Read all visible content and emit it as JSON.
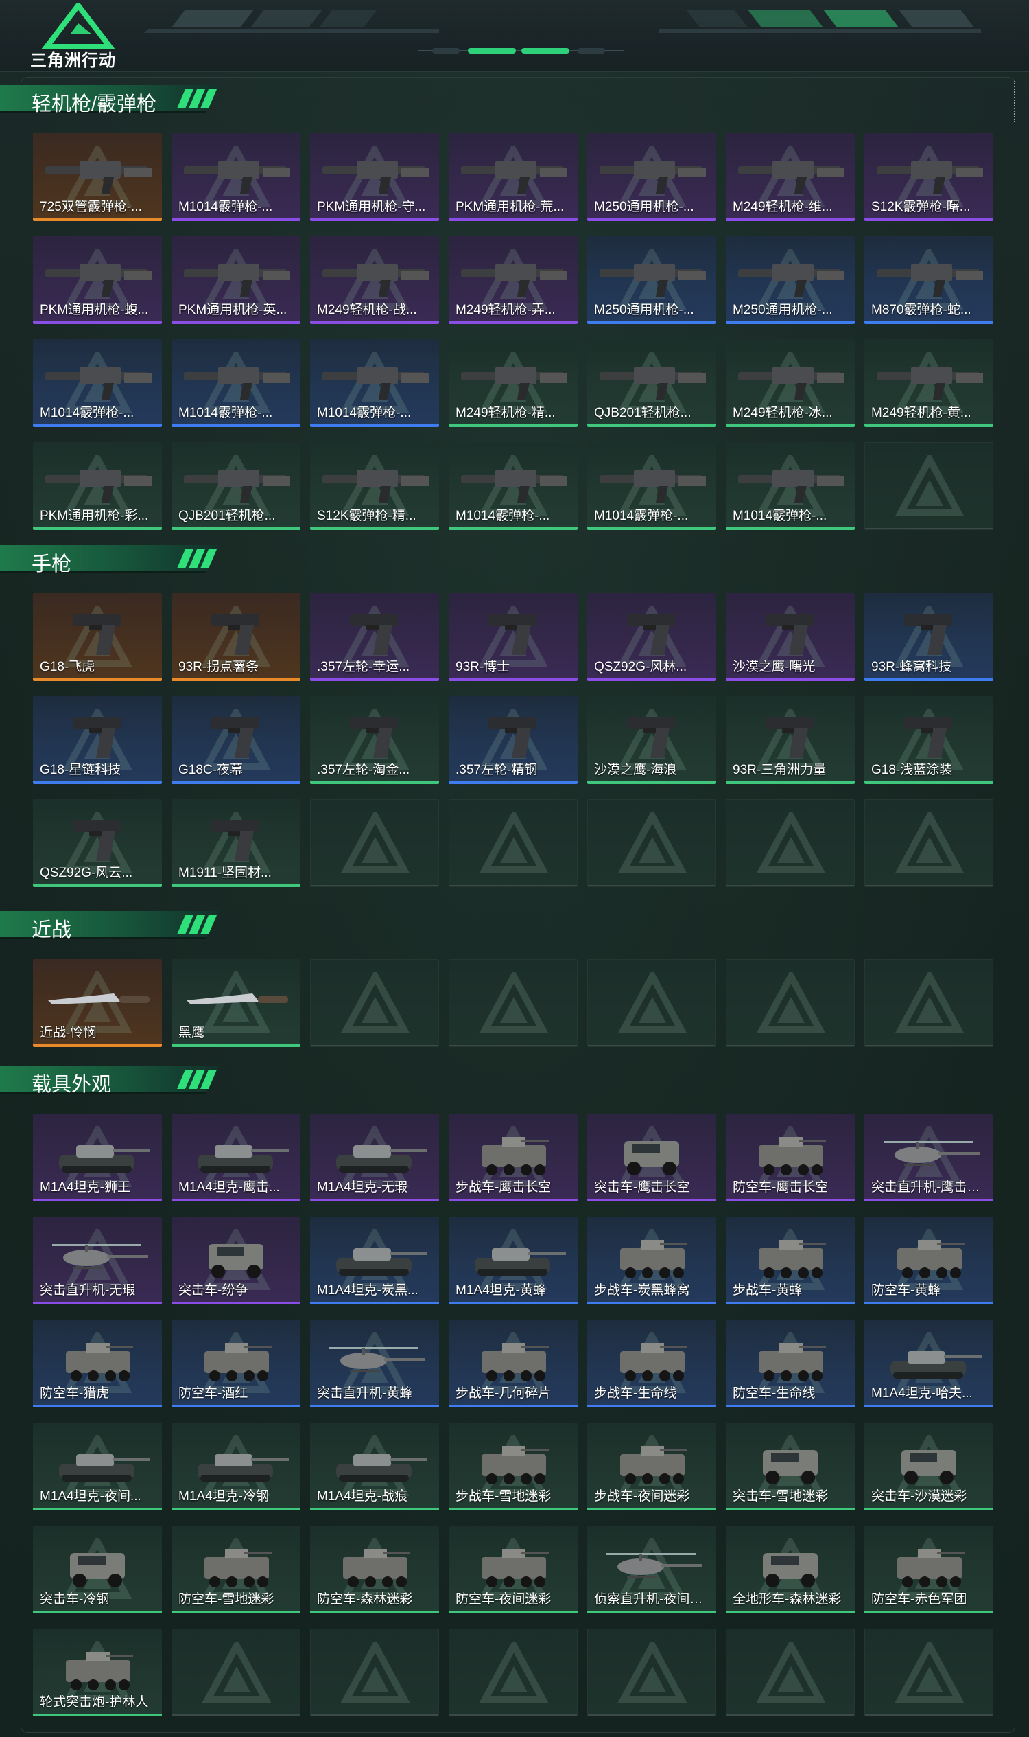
{
  "app": {
    "title": "三角洲行动"
  },
  "colors": {
    "purple": "#8a4de6",
    "blue": "#3f7cf0",
    "orange": "#e88a2a",
    "green": "#3fc77e",
    "accent": "#2fc46f"
  },
  "sections": [
    {
      "title": "轻机枪/霰弹枪",
      "columns": 7,
      "items": [
        {
          "label": "725双管霰弹枪-...",
          "rarity": "orange",
          "icon": "shotgun-icon"
        },
        {
          "label": "M1014霰弹枪-...",
          "rarity": "purple",
          "icon": "shotgun-icon"
        },
        {
          "label": "PKM通用机枪-守...",
          "rarity": "purple",
          "icon": "machine-gun-icon"
        },
        {
          "label": "PKM通用机枪-荒...",
          "rarity": "purple",
          "icon": "machine-gun-icon"
        },
        {
          "label": "M250通用机枪-...",
          "rarity": "purple",
          "icon": "machine-gun-icon"
        },
        {
          "label": "M249轻机枪-维...",
          "rarity": "purple",
          "icon": "machine-gun-icon"
        },
        {
          "label": "S12K霰弹枪-曙...",
          "rarity": "purple",
          "icon": "shotgun-icon"
        },
        {
          "label": "PKM通用机枪-蝮...",
          "rarity": "purple",
          "icon": "machine-gun-icon"
        },
        {
          "label": "PKM通用机枪-英...",
          "rarity": "purple",
          "icon": "machine-gun-icon"
        },
        {
          "label": "M249轻机枪-战...",
          "rarity": "purple",
          "icon": "machine-gun-icon"
        },
        {
          "label": "M249轻机枪-弄...",
          "rarity": "purple",
          "icon": "machine-gun-icon"
        },
        {
          "label": "M250通用机枪-...",
          "rarity": "blue",
          "icon": "machine-gun-icon"
        },
        {
          "label": "M250通用机枪-...",
          "rarity": "blue",
          "icon": "machine-gun-icon"
        },
        {
          "label": "M870霰弹枪-蛇...",
          "rarity": "blue",
          "icon": "shotgun-icon"
        },
        {
          "label": "M1014霰弹枪-...",
          "rarity": "blue",
          "icon": "shotgun-icon"
        },
        {
          "label": "M1014霰弹枪-...",
          "rarity": "blue",
          "icon": "shotgun-icon"
        },
        {
          "label": "M1014霰弹枪-...",
          "rarity": "blue",
          "icon": "shotgun-icon"
        },
        {
          "label": "M249轻机枪-精...",
          "rarity": "green",
          "icon": "machine-gun-icon"
        },
        {
          "label": "QJB201轻机枪...",
          "rarity": "green",
          "icon": "machine-gun-icon"
        },
        {
          "label": "M249轻机枪-冰...",
          "rarity": "green",
          "icon": "machine-gun-icon"
        },
        {
          "label": "M249轻机枪-黄...",
          "rarity": "green",
          "icon": "machine-gun-icon"
        },
        {
          "label": "PKM通用机枪-彩...",
          "rarity": "green",
          "icon": "machine-gun-icon"
        },
        {
          "label": "QJB201轻机枪...",
          "rarity": "green",
          "icon": "machine-gun-icon"
        },
        {
          "label": "S12K霰弹枪-精...",
          "rarity": "green",
          "icon": "shotgun-icon"
        },
        {
          "label": "M1014霰弹枪-...",
          "rarity": "green",
          "icon": "shotgun-icon"
        },
        {
          "label": "M1014霰弹枪-...",
          "rarity": "green",
          "icon": "shotgun-icon"
        },
        {
          "label": "M1014霰弹枪-...",
          "rarity": "green",
          "icon": "shotgun-icon"
        },
        {
          "label": "",
          "rarity": "empty",
          "icon": ""
        }
      ]
    },
    {
      "title": "手枪",
      "columns": 7,
      "items": [
        {
          "label": "G18-飞虎",
          "rarity": "orange",
          "icon": "pistol-icon"
        },
        {
          "label": "93R-拐点薯条",
          "rarity": "orange",
          "icon": "pistol-icon"
        },
        {
          "label": ".357左轮-幸运...",
          "rarity": "purple",
          "icon": "revolver-icon"
        },
        {
          "label": "93R-博士",
          "rarity": "purple",
          "icon": "pistol-icon"
        },
        {
          "label": "QSZ92G-风林...",
          "rarity": "purple",
          "icon": "pistol-icon"
        },
        {
          "label": "沙漠之鹰-曙光",
          "rarity": "purple",
          "icon": "pistol-icon"
        },
        {
          "label": "93R-蜂窝科技",
          "rarity": "blue",
          "icon": "pistol-icon"
        },
        {
          "label": "G18-星链科技",
          "rarity": "blue",
          "icon": "pistol-icon"
        },
        {
          "label": "G18C-夜幕",
          "rarity": "blue",
          "icon": "pistol-icon"
        },
        {
          "label": ".357左轮-淘金...",
          "rarity": "green",
          "icon": "revolver-icon"
        },
        {
          "label": ".357左轮-精钢",
          "rarity": "blue",
          "icon": "revolver-icon"
        },
        {
          "label": "沙漠之鹰-海浪",
          "rarity": "green",
          "icon": "pistol-icon"
        },
        {
          "label": "93R-三角洲力量",
          "rarity": "green",
          "icon": "pistol-icon"
        },
        {
          "label": "G18-浅蓝涂装",
          "rarity": "green",
          "icon": "pistol-icon"
        },
        {
          "label": "QSZ92G-风云...",
          "rarity": "green",
          "icon": "pistol-icon"
        },
        {
          "label": "M1911-坚固材...",
          "rarity": "green",
          "icon": "pistol-icon"
        },
        {
          "label": "",
          "rarity": "empty",
          "icon": ""
        },
        {
          "label": "",
          "rarity": "empty",
          "icon": ""
        },
        {
          "label": "",
          "rarity": "empty",
          "icon": ""
        },
        {
          "label": "",
          "rarity": "empty",
          "icon": ""
        },
        {
          "label": "",
          "rarity": "empty",
          "icon": ""
        }
      ]
    },
    {
      "title": "近战",
      "columns": 7,
      "items": [
        {
          "label": "近战-怜悯",
          "rarity": "orange",
          "icon": "blade-icon"
        },
        {
          "label": "黑鹰",
          "rarity": "green",
          "icon": "knife-icon"
        },
        {
          "label": "",
          "rarity": "empty",
          "icon": ""
        },
        {
          "label": "",
          "rarity": "empty",
          "icon": ""
        },
        {
          "label": "",
          "rarity": "empty",
          "icon": ""
        },
        {
          "label": "",
          "rarity": "empty",
          "icon": ""
        },
        {
          "label": "",
          "rarity": "empty",
          "icon": ""
        }
      ]
    },
    {
      "title": "载具外观",
      "columns": 7,
      "items": [
        {
          "label": "M1A4坦克-狮王",
          "rarity": "purple",
          "icon": "tank-icon"
        },
        {
          "label": "M1A4坦克-鹰击...",
          "rarity": "purple",
          "icon": "tank-icon"
        },
        {
          "label": "M1A4坦克-无瑕",
          "rarity": "purple",
          "icon": "tank-icon"
        },
        {
          "label": "步战车-鹰击长空",
          "rarity": "purple",
          "icon": "ifv-icon"
        },
        {
          "label": "突击车-鹰击长空",
          "rarity": "purple",
          "icon": "assault-vehicle-icon"
        },
        {
          "label": "防空车-鹰击长空",
          "rarity": "purple",
          "icon": "ifv-icon"
        },
        {
          "label": "突击直升机-鹰击长...",
          "rarity": "purple",
          "icon": "helicopter-icon"
        },
        {
          "label": "突击直升机-无瑕",
          "rarity": "purple",
          "icon": "helicopter-icon"
        },
        {
          "label": "突击车-纷争",
          "rarity": "purple",
          "icon": "assault-vehicle-icon"
        },
        {
          "label": "M1A4坦克-炭黑...",
          "rarity": "blue",
          "icon": "tank-icon"
        },
        {
          "label": "M1A4坦克-黄蜂",
          "rarity": "blue",
          "icon": "tank-icon"
        },
        {
          "label": "步战车-炭黑蜂窝",
          "rarity": "blue",
          "icon": "ifv-icon"
        },
        {
          "label": "步战车-黄蜂",
          "rarity": "blue",
          "icon": "ifv-icon"
        },
        {
          "label": "防空车-黄蜂",
          "rarity": "blue",
          "icon": "ifv-icon"
        },
        {
          "label": "防空车-猎虎",
          "rarity": "blue",
          "icon": "ifv-icon"
        },
        {
          "label": "防空车-酒红",
          "rarity": "blue",
          "icon": "ifv-icon"
        },
        {
          "label": "突击直升机-黄蜂",
          "rarity": "blue",
          "icon": "helicopter-icon"
        },
        {
          "label": "步战车-几何碎片",
          "rarity": "blue",
          "icon": "ifv-icon"
        },
        {
          "label": "步战车-生命线",
          "rarity": "blue",
          "icon": "ifv-icon"
        },
        {
          "label": "防空车-生命线",
          "rarity": "blue",
          "icon": "ifv-icon"
        },
        {
          "label": "M1A4坦克-哈夫...",
          "rarity": "blue",
          "icon": "tank-icon"
        },
        {
          "label": "M1A4坦克-夜间...",
          "rarity": "green",
          "icon": "tank-icon"
        },
        {
          "label": "M1A4坦克-冷钢",
          "rarity": "green",
          "icon": "tank-icon"
        },
        {
          "label": "M1A4坦克-战痕",
          "rarity": "green",
          "icon": "tank-icon"
        },
        {
          "label": "步战车-雪地迷彩",
          "rarity": "green",
          "icon": "ifv-icon"
        },
        {
          "label": "步战车-夜间迷彩",
          "rarity": "green",
          "icon": "ifv-icon"
        },
        {
          "label": "突击车-雪地迷彩",
          "rarity": "green",
          "icon": "assault-vehicle-icon"
        },
        {
          "label": "突击车-沙漠迷彩",
          "rarity": "green",
          "icon": "assault-vehicle-icon"
        },
        {
          "label": "突击车-冷钢",
          "rarity": "green",
          "icon": "assault-vehicle-icon"
        },
        {
          "label": "防空车-雪地迷彩",
          "rarity": "green",
          "icon": "ifv-icon"
        },
        {
          "label": "防空车-森林迷彩",
          "rarity": "green",
          "icon": "ifv-icon"
        },
        {
          "label": "防空车-夜间迷彩",
          "rarity": "green",
          "icon": "ifv-icon"
        },
        {
          "label": "侦察直升机-夜间迷...",
          "rarity": "green",
          "icon": "helicopter-icon"
        },
        {
          "label": "全地形车-森林迷彩",
          "rarity": "green",
          "icon": "atv-icon"
        },
        {
          "label": "防空车-赤色军团",
          "rarity": "green",
          "icon": "ifv-icon"
        },
        {
          "label": "轮式突击炮-护林人",
          "rarity": "green",
          "icon": "assault-gun-icon"
        },
        {
          "label": "",
          "rarity": "empty",
          "icon": ""
        },
        {
          "label": "",
          "rarity": "empty",
          "icon": ""
        },
        {
          "label": "",
          "rarity": "empty",
          "icon": ""
        },
        {
          "label": "",
          "rarity": "empty",
          "icon": ""
        },
        {
          "label": "",
          "rarity": "empty",
          "icon": ""
        },
        {
          "label": "",
          "rarity": "empty",
          "icon": ""
        }
      ]
    }
  ]
}
